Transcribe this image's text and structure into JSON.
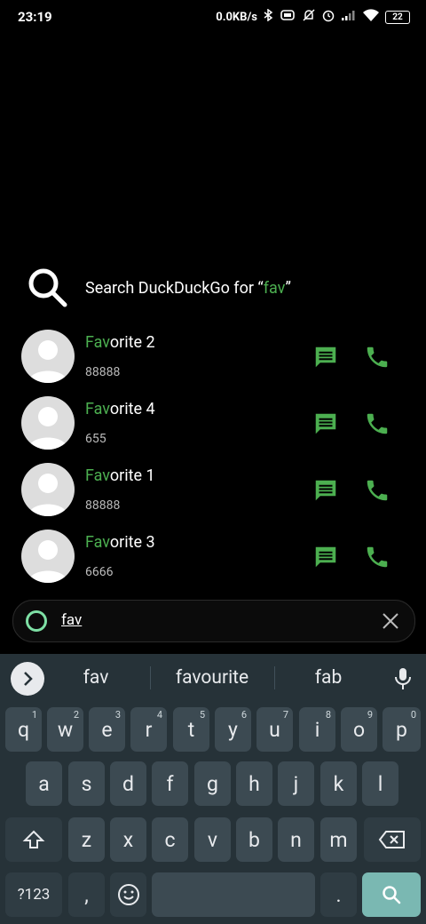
{
  "status": {
    "time": "23:19",
    "net_speed": "0.0KB/s",
    "battery": "22"
  },
  "search": {
    "prefix": "Search DuckDuckGo for “",
    "term": "fav",
    "suffix": "”"
  },
  "contacts": [
    {
      "name_hl": "Fav",
      "name_rest": "orite 2",
      "number": "88888"
    },
    {
      "name_hl": "Fav",
      "name_rest": "orite 4",
      "number": "655"
    },
    {
      "name_hl": "Fav",
      "name_rest": "orite 1",
      "number": "88888"
    },
    {
      "name_hl": "Fav",
      "name_rest": "orite 3",
      "number": "6666"
    }
  ],
  "query": {
    "value": "fav"
  },
  "keyboard": {
    "suggestions": [
      "fav",
      "favourite",
      "fab"
    ],
    "row1": [
      {
        "k": "q",
        "h": "1"
      },
      {
        "k": "w",
        "h": "2"
      },
      {
        "k": "e",
        "h": "3"
      },
      {
        "k": "r",
        "h": "4"
      },
      {
        "k": "t",
        "h": "5"
      },
      {
        "k": "y",
        "h": "6"
      },
      {
        "k": "u",
        "h": "7"
      },
      {
        "k": "i",
        "h": "8"
      },
      {
        "k": "o",
        "h": "9"
      },
      {
        "k": "p",
        "h": "0"
      }
    ],
    "row2": [
      "a",
      "s",
      "d",
      "f",
      "g",
      "h",
      "j",
      "k",
      "l"
    ],
    "row3": [
      "z",
      "x",
      "c",
      "v",
      "b",
      "n",
      "m"
    ],
    "symbols_key": "?123",
    "comma_key": ",",
    "period_key": "."
  },
  "colors": {
    "accent_green": "#4caf50",
    "keyboard_bg": "#263238",
    "key_bg": "#3c4a52",
    "search_key": "#7ab8b2"
  }
}
